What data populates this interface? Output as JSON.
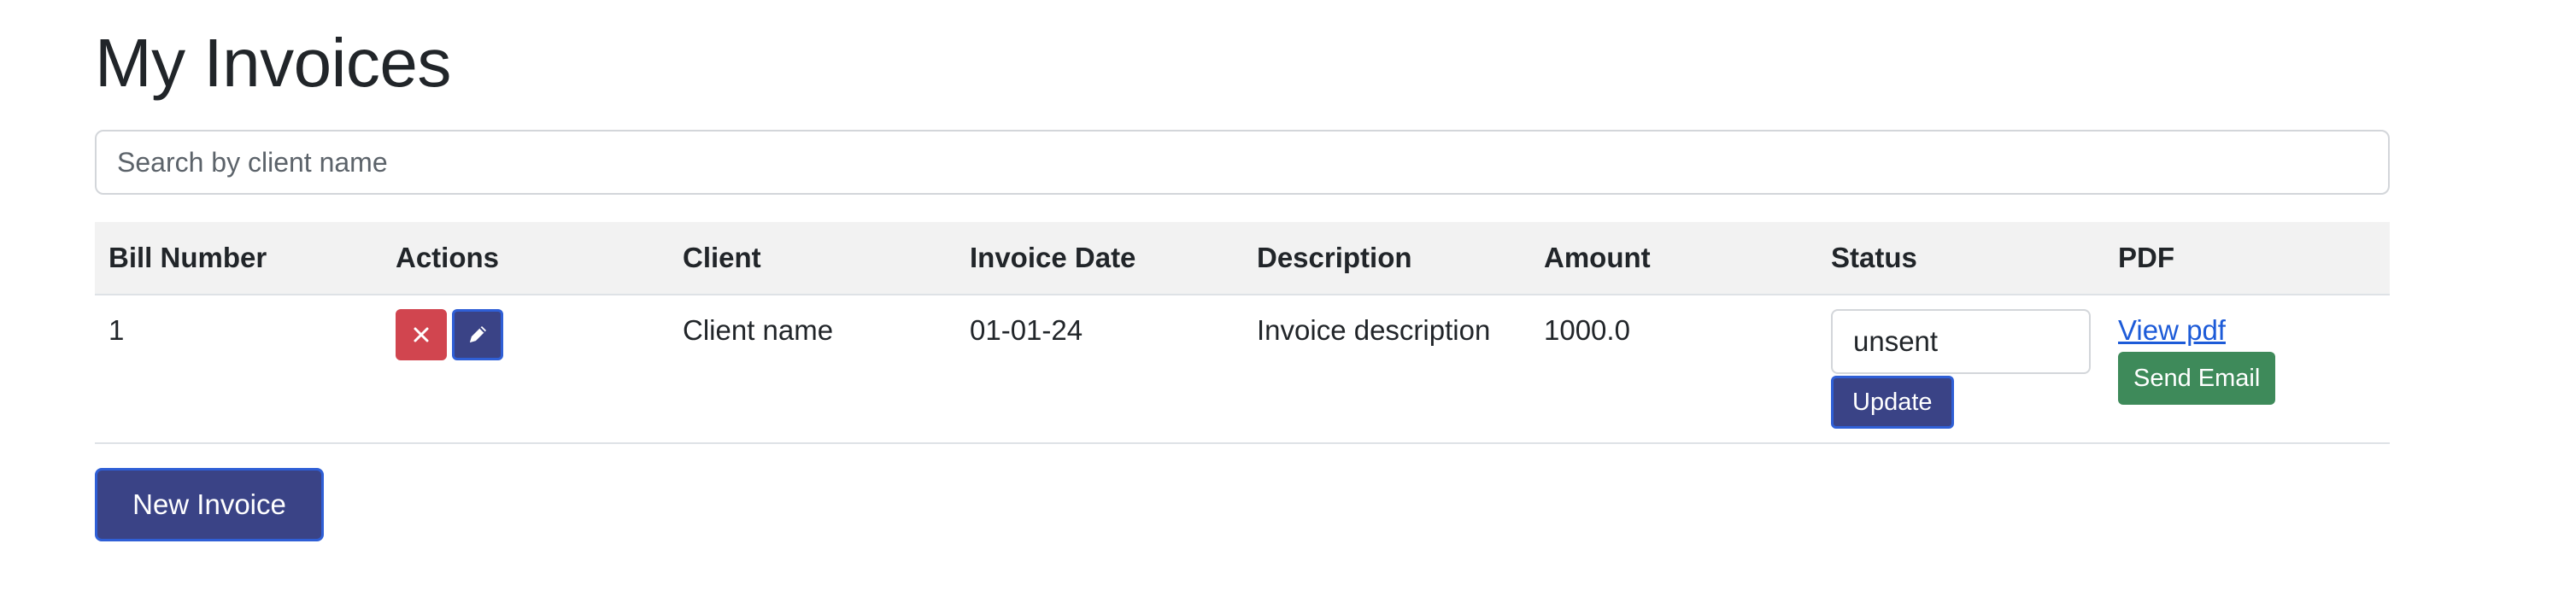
{
  "page": {
    "title": "My Invoices"
  },
  "search": {
    "placeholder": "Search by client name",
    "value": ""
  },
  "table": {
    "headers": {
      "bill_number": "Bill Number",
      "actions": "Actions",
      "client": "Client",
      "invoice_date": "Invoice Date",
      "description": "Description",
      "amount": "Amount",
      "status": "Status",
      "pdf": "PDF"
    },
    "rows": [
      {
        "bill_number": "1",
        "client": "Client name",
        "invoice_date": "01-01-24",
        "description": "Invoice description",
        "amount": "1000.0",
        "status": "unsent",
        "update_label": "Update",
        "view_pdf_label": "View pdf",
        "send_email_label": "Send Email"
      }
    ]
  },
  "actions": {
    "delete_icon": "close-icon",
    "edit_icon": "pencil-icon"
  },
  "footer": {
    "new_invoice_label": "New Invoice"
  },
  "colors": {
    "primary": "#3a4386",
    "danger": "#d1454f",
    "success": "#3e8a5a",
    "link": "#1d5bd8",
    "header_bg": "#f2f2f2"
  }
}
